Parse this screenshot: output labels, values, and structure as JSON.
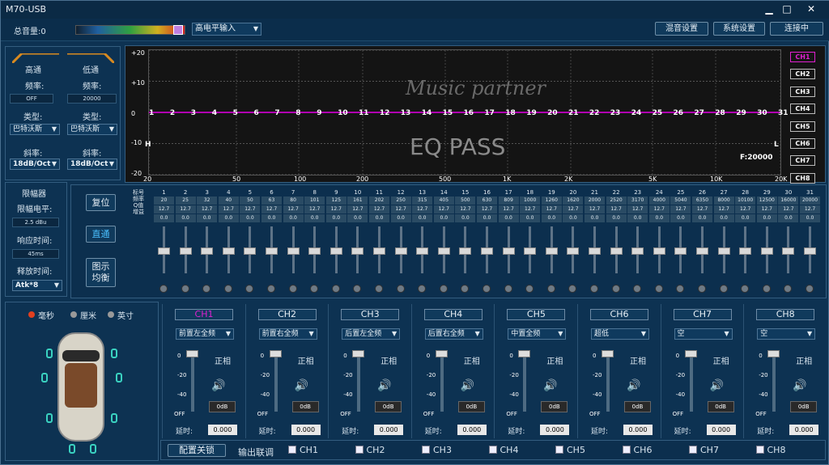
{
  "app": {
    "title": "M70-USB",
    "min": "▁",
    "max": "□",
    "close": "✕"
  },
  "toolbar": {
    "volume_label": "总音量:0",
    "input_mode": "高电平输入",
    "mix_button": "混音设置",
    "system_button": "系统设置",
    "connect_button": "连接中"
  },
  "crossover": {
    "hp": {
      "title": "高通",
      "freq_label": "频率:",
      "freq": "OFF",
      "type_label": "类型:",
      "type": "巴特沃斯",
      "slope_label": "斜率:",
      "slope": "18dB/Oct"
    },
    "lp": {
      "title": "低通",
      "freq_label": "频率:",
      "freq": "20000",
      "type_label": "类型:",
      "type": "巴特沃斯",
      "slope_label": "斜率:",
      "slope": "18dB/Oct"
    }
  },
  "limiter": {
    "title": "限幅器",
    "level_label": "限幅电平:",
    "level": "2.5 dBu",
    "response_label": "响应时间:",
    "response": "45ms",
    "release_label": "释放时间:",
    "release": "Atk*8"
  },
  "buttons": {
    "reset": "复位",
    "bypass": "直通",
    "graph_eq": "图示\n均衡"
  },
  "graph": {
    "y_ticks": [
      "+20",
      "+10",
      "0",
      "-10",
      "-20"
    ],
    "x_ticks": [
      "20",
      "50",
      "100",
      "200",
      "500",
      "1K",
      "2K",
      "5K",
      "10K",
      "20K"
    ],
    "left_marker": "H",
    "right_marker": "L",
    "freq_readout": "F:20000",
    "overlay": "EQ PASS",
    "logo_text": "Music partner",
    "band_numbers": [
      "1",
      "2",
      "3",
      "4",
      "5",
      "6",
      "7",
      "8",
      "9",
      "10",
      "11",
      "12",
      "13",
      "14",
      "15",
      "16",
      "17",
      "18",
      "19",
      "20",
      "21",
      "22",
      "23",
      "24",
      "25",
      "26",
      "27",
      "28",
      "29",
      "30",
      "31"
    ]
  },
  "channels_side": [
    "CH1",
    "CH2",
    "CH3",
    "CH4",
    "CH5",
    "CH6",
    "CH7",
    "CH8"
  ],
  "eq_table": {
    "row_labels": [
      "标号",
      "频率",
      "Q值",
      "增益"
    ],
    "bands": [
      "1",
      "2",
      "3",
      "4",
      "5",
      "6",
      "7",
      "8",
      "9",
      "10",
      "11",
      "12",
      "13",
      "14",
      "15",
      "16",
      "17",
      "18",
      "19",
      "20",
      "21",
      "22",
      "23",
      "24",
      "25",
      "26",
      "27",
      "28",
      "29",
      "30",
      "31"
    ],
    "freqs": [
      "20",
      "25",
      "32",
      "40",
      "50",
      "63",
      "80",
      "101",
      "125",
      "161",
      "202",
      "250",
      "315",
      "405",
      "500",
      "630",
      "809",
      "1000",
      "1260",
      "1620",
      "2000",
      "2520",
      "3170",
      "4000",
      "5040",
      "6350",
      "8000",
      "10100",
      "12500",
      "16000",
      "20000"
    ],
    "q": "12.7",
    "gain": "0.0"
  },
  "units": {
    "ms": "毫秒",
    "cm": "厘米",
    "inch": "英寸"
  },
  "outputs": [
    {
      "name": "CH1",
      "pos": "前置左全频",
      "phase": "正相",
      "gain": "0dB",
      "delay_label": "延时:",
      "delay": "0.000"
    },
    {
      "name": "CH2",
      "pos": "前置右全频",
      "phase": "正相",
      "gain": "0dB",
      "delay_label": "延时:",
      "delay": "0.000"
    },
    {
      "name": "CH3",
      "pos": "后置左全频",
      "phase": "正相",
      "gain": "0dB",
      "delay_label": "延时:",
      "delay": "0.000"
    },
    {
      "name": "CH4",
      "pos": "后置右全频",
      "phase": "正相",
      "gain": "0dB",
      "delay_label": "延时:",
      "delay": "0.000"
    },
    {
      "name": "CH5",
      "pos": "中置全频",
      "phase": "正相",
      "gain": "0dB",
      "delay_label": "延时:",
      "delay": "0.000"
    },
    {
      "name": "CH6",
      "pos": "超低",
      "phase": "正相",
      "gain": "0dB",
      "delay_label": "延时:",
      "delay": "0.000"
    },
    {
      "name": "CH7",
      "pos": "空",
      "phase": "正相",
      "gain": "0dB",
      "delay_label": "延时:",
      "delay": "0.000"
    },
    {
      "name": "CH8",
      "pos": "空",
      "phase": "正相",
      "gain": "0dB",
      "delay_label": "延时:",
      "delay": "0.000"
    }
  ],
  "scale": [
    "0",
    "-20",
    "-40",
    "OFF"
  ],
  "footer": {
    "lock_button": "配置关锁",
    "link_label": "输出联调",
    "checks": [
      "CH1",
      "CH2",
      "CH3",
      "CH4",
      "CH5",
      "CH6",
      "CH7",
      "CH8"
    ]
  },
  "colors": {
    "curve": "#b000b0",
    "active": "#e020d0"
  }
}
